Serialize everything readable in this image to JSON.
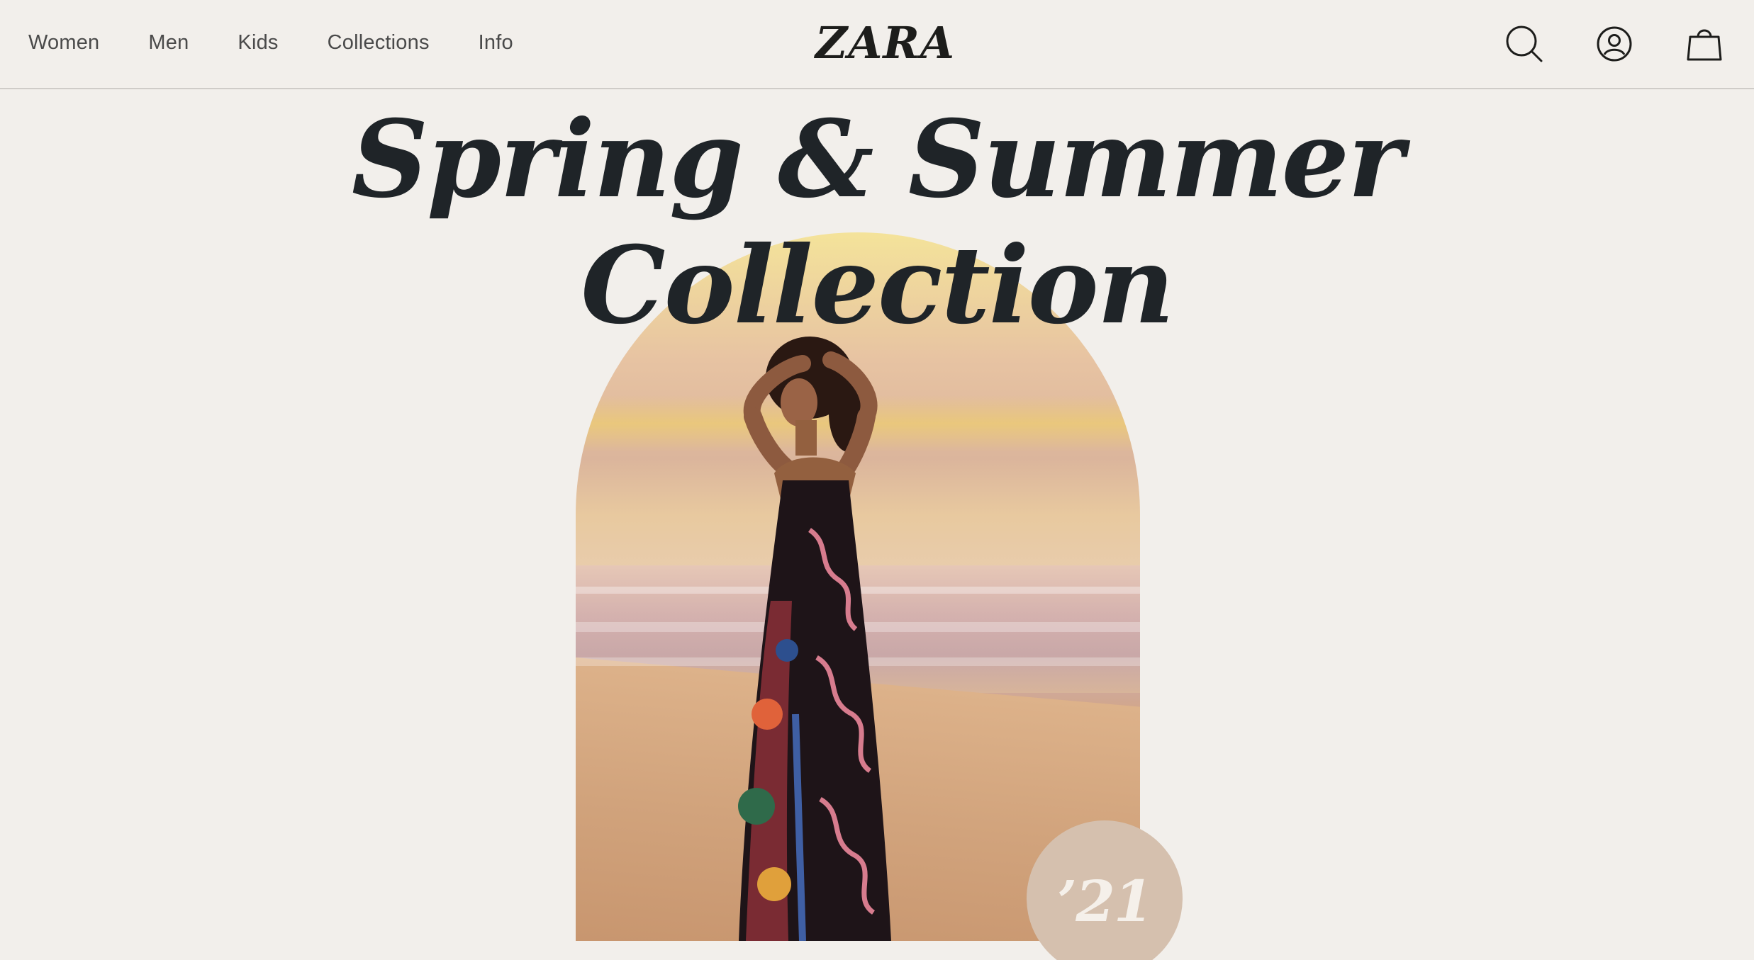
{
  "header": {
    "nav": [
      "Women",
      "Men",
      "Kids",
      "Collections",
      "Info"
    ],
    "brand": "ZARA",
    "icons": [
      "search-icon",
      "account-icon",
      "shopping-bag-icon"
    ]
  },
  "hero": {
    "title_line1": "Spring & Summer",
    "title_line2": "Collection",
    "badge": "’21"
  },
  "colors": {
    "background": "#f2efeb",
    "title": "#1f2428",
    "badge": "#d5c0ae",
    "badge_text": "#f5f0ea"
  }
}
